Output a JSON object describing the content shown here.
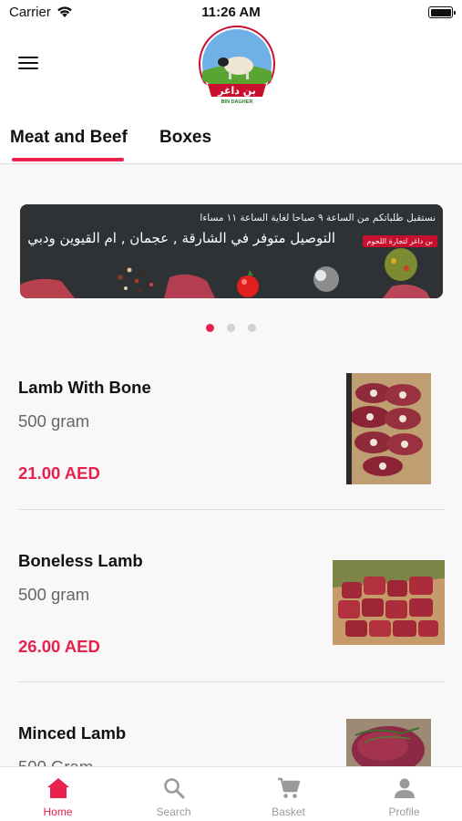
{
  "status_bar": {
    "carrier": "Carrier",
    "time": "11:26 AM"
  },
  "header": {
    "menu_icon": "hamburger-icon",
    "logo_arabic": "بن داغر",
    "logo_english": "BIN DAGHER"
  },
  "tabs": [
    {
      "label": "Meat and Beef",
      "active": true
    },
    {
      "label": "Boxes",
      "active": false
    }
  ],
  "banner": {
    "line1": "نستقبل طلباتكم من الساعة ٩ صباحا لغاية الساعة ١١ مساءا",
    "line2": "التوصيل متوفر في الشارقة , عجمان , ام القيوين ودبي",
    "tag": "بن داغر لتجارة اللحوم",
    "slides": 3,
    "active_slide": 1
  },
  "products": [
    {
      "name": "Lamb With Bone",
      "weight": "500 gram",
      "price": "21.00 AED"
    },
    {
      "name": "Boneless Lamb",
      "weight": "500 gram",
      "price": "26.00 AED"
    },
    {
      "name": "Minced Lamb",
      "weight": "500 Gram",
      "price": ""
    }
  ],
  "bottom_nav": [
    {
      "label": "Home",
      "icon": "home-icon",
      "active": true
    },
    {
      "label": "Search",
      "icon": "search-icon",
      "active": false
    },
    {
      "label": "Basket",
      "icon": "cart-icon",
      "active": false
    },
    {
      "label": "Profile",
      "icon": "person-icon",
      "active": false
    }
  ],
  "colors": {
    "accent": "#e8214f",
    "inactive": "#9a9a9a",
    "background": "#f8f8f8"
  }
}
